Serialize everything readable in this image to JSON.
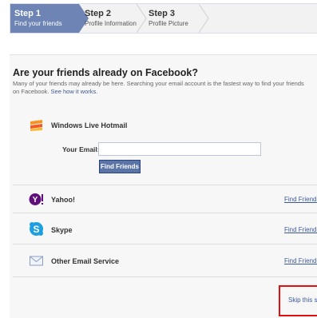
{
  "steps": [
    {
      "number": "Step 1",
      "label": "Find your friends",
      "active": true
    },
    {
      "number": "Step 2",
      "label": "Profile Information",
      "active": false
    },
    {
      "number": "Step 3",
      "label": "Profile Picture",
      "active": false
    }
  ],
  "main": {
    "title": "Are your friends already on Facebook?",
    "description": "Many of your friends may already be here. Searching your email account is the fastest way to find your friends on Facebook.",
    "how_link": "See how it works."
  },
  "hotmail": {
    "service": "Windows Live Hotmail",
    "email_label": "Your Email:",
    "email_value": "",
    "email_placeholder": "",
    "find_button": "Find Friends"
  },
  "services": [
    {
      "name": "Yahoo!",
      "icon": "yahoo-icon",
      "link": "Find Friends"
    },
    {
      "name": "Skype",
      "icon": "skype-icon",
      "link": "Find Friends"
    },
    {
      "name": "Other Email Service",
      "icon": "envelope-icon",
      "link": "Find Friends"
    }
  ],
  "skip_link": "Skip this step",
  "colors": {
    "accent": "#6d84b4",
    "button": "#5b74a8",
    "link": "#3b5998",
    "highlight": "#e01010"
  }
}
